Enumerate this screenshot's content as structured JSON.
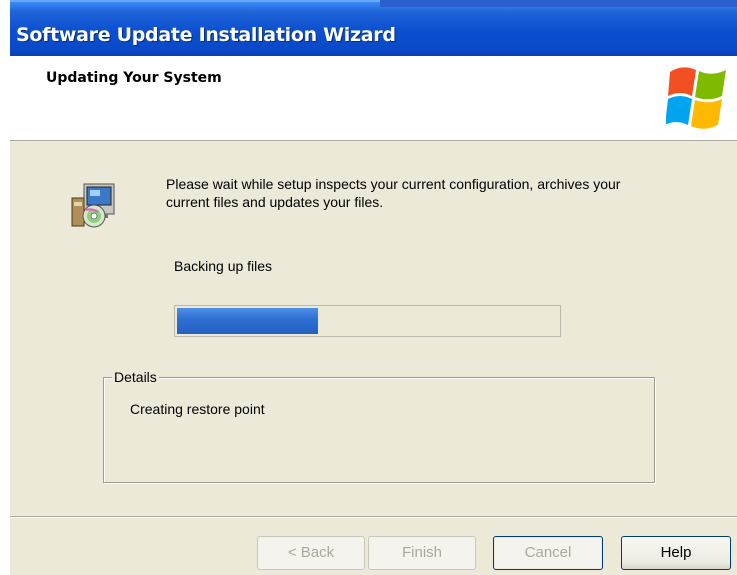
{
  "window": {
    "title": "Software Update Installation Wizard"
  },
  "header": {
    "heading": "Updating Your System",
    "logo_icon": "windows-logo-icon"
  },
  "body": {
    "setup_icon": "setup-package-icon",
    "intro_text": "Please wait while setup inspects your current configuration, archives your current files and updates your files.",
    "status_text": "Backing up files",
    "progress_fraction": 0.37
  },
  "details": {
    "legend": "Details",
    "text": "Creating restore point"
  },
  "buttons": {
    "back": "< Back",
    "finish": "Finish",
    "cancel": "Cancel",
    "help": "Help"
  },
  "colors": {
    "title_bar": "#0a49c6",
    "dialog_bg": "#ece9d8",
    "progress_fill": "#2d6fd1"
  }
}
